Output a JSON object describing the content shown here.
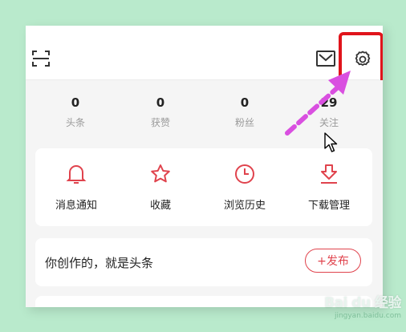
{
  "stats": [
    {
      "value": "0",
      "label": "头条"
    },
    {
      "value": "0",
      "label": "获赞"
    },
    {
      "value": "0",
      "label": "粉丝"
    },
    {
      "value": "29",
      "label": "关注"
    }
  ],
  "quick_actions": [
    {
      "label": "消息通知",
      "icon": "bell-icon"
    },
    {
      "label": "收藏",
      "icon": "star-icon"
    },
    {
      "label": "浏览历史",
      "icon": "clock-icon"
    },
    {
      "label": "下载管理",
      "icon": "download-icon"
    }
  ],
  "publish": {
    "text": "你创作的，就是头条",
    "button_label": "+发布"
  },
  "watermark": {
    "logo_text": "Bai du 经验",
    "url": "jingyan.baidu.com"
  },
  "colors": {
    "accent": "#e0434d",
    "highlight_box": "#e0141b",
    "arrow": "#d94fe0",
    "background": "#b9eacc"
  }
}
